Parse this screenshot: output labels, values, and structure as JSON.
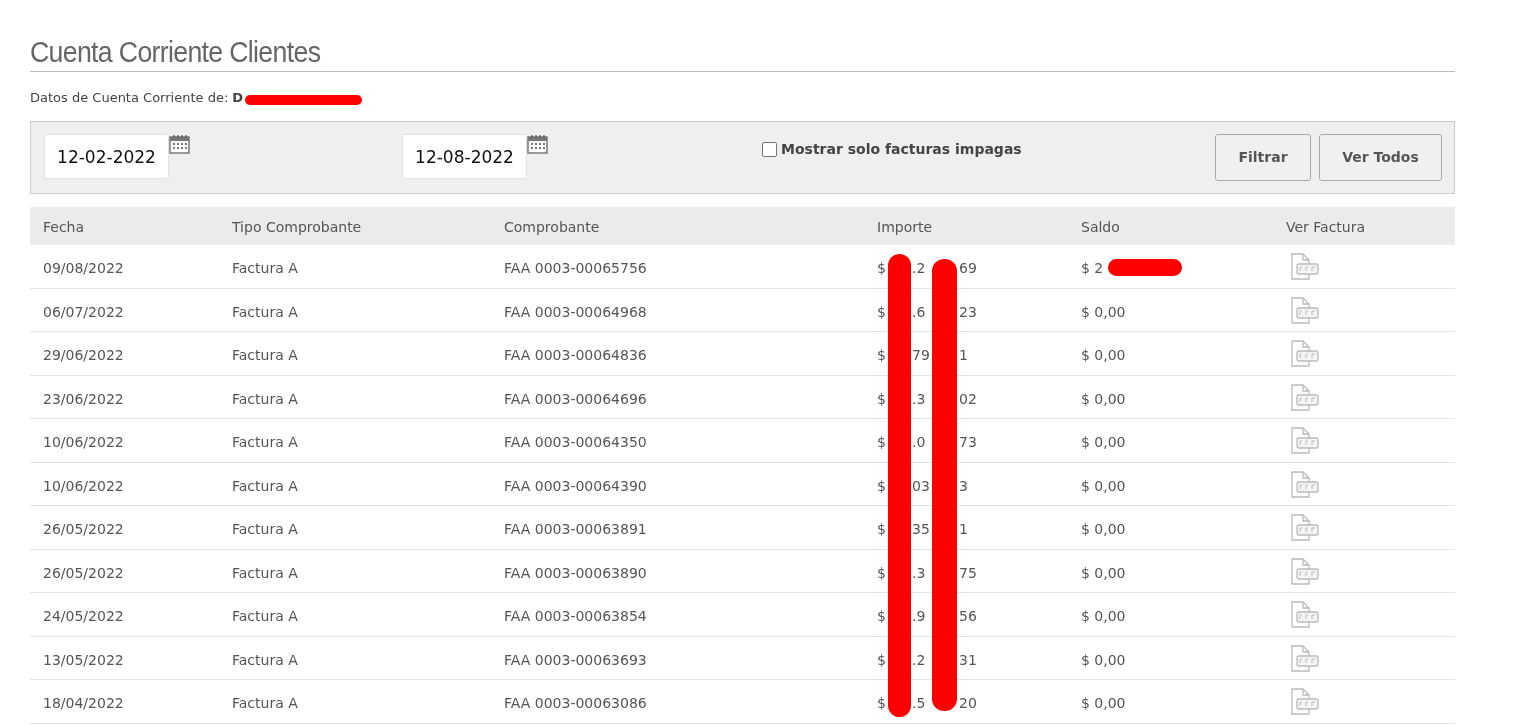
{
  "title": "Cuenta Corriente Clientes",
  "account": {
    "label": "Datos de Cuenta Corriente de:",
    "name_visible": "D"
  },
  "filter": {
    "date_from": "12-02-2022",
    "date_to": "12-08-2022",
    "unpaid_only": {
      "label": "Mostrar solo facturas impagas",
      "checked": false
    },
    "buttons": [
      "Filtrar",
      "Ver Todos"
    ]
  },
  "table": {
    "columns": [
      "Fecha",
      "Tipo Comprobante",
      "Comprobante",
      "Importe",
      "Saldo",
      "Ver Factura"
    ],
    "rows": [
      {
        "fecha": "09/08/2022",
        "tipo": "Factura A",
        "comprobante": "FAA 0003-00065756",
        "importe": [
          "$",
          ".2",
          "69"
        ],
        "saldo": "$ 2",
        "saldo_redacted": true
      },
      {
        "fecha": "06/07/2022",
        "tipo": "Factura A",
        "comprobante": "FAA 0003-00064968",
        "importe": [
          "$",
          ".6",
          "23"
        ],
        "saldo": "$ 0,00",
        "saldo_redacted": false
      },
      {
        "fecha": "29/06/2022",
        "tipo": "Factura A",
        "comprobante": "FAA 0003-00064836",
        "importe": [
          "$",
          "79",
          "1"
        ],
        "saldo": "$ 0,00",
        "saldo_redacted": false
      },
      {
        "fecha": "23/06/2022",
        "tipo": "Factura A",
        "comprobante": "FAA 0003-00064696",
        "importe": [
          "$",
          ".3",
          "02"
        ],
        "saldo": "$ 0,00",
        "saldo_redacted": false
      },
      {
        "fecha": "10/06/2022",
        "tipo": "Factura A",
        "comprobante": "FAA 0003-00064350",
        "importe": [
          "$",
          ".0",
          "73"
        ],
        "saldo": "$ 0,00",
        "saldo_redacted": false
      },
      {
        "fecha": "10/06/2022",
        "tipo": "Factura A",
        "comprobante": "FAA 0003-00064390",
        "importe": [
          "$",
          "03",
          "3"
        ],
        "saldo": "$ 0,00",
        "saldo_redacted": false
      },
      {
        "fecha": "26/05/2022",
        "tipo": "Factura A",
        "comprobante": "FAA 0003-00063891",
        "importe": [
          "$",
          "35",
          "1"
        ],
        "saldo": "$ 0,00",
        "saldo_redacted": false
      },
      {
        "fecha": "26/05/2022",
        "tipo": "Factura A",
        "comprobante": "FAA 0003-00063890",
        "importe": [
          "$",
          ".3",
          "75"
        ],
        "saldo": "$ 0,00",
        "saldo_redacted": false
      },
      {
        "fecha": "24/05/2022",
        "tipo": "Factura A",
        "comprobante": "FAA 0003-00063854",
        "importe": [
          "$",
          ".9",
          "56"
        ],
        "saldo": "$ 0,00",
        "saldo_redacted": false
      },
      {
        "fecha": "13/05/2022",
        "tipo": "Factura A",
        "comprobante": "FAA 0003-00063693",
        "importe": [
          "$",
          ".2",
          "31"
        ],
        "saldo": "$ 0,00",
        "saldo_redacted": false
      },
      {
        "fecha": "18/04/2022",
        "tipo": "Factura A",
        "comprobante": "FAA 0003-00063086",
        "importe": [
          "$",
          ".5",
          "20"
        ],
        "saldo": "$ 0,00",
        "saldo_redacted": false
      }
    ]
  }
}
